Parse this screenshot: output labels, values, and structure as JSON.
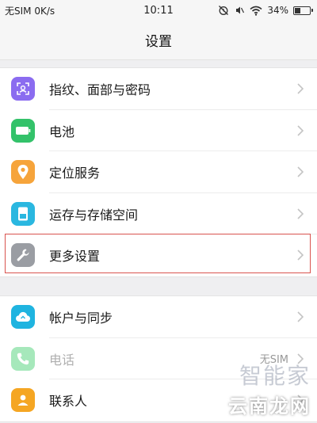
{
  "status_bar": {
    "carrier": "无SIM 0K/s",
    "time": "10:11",
    "battery": "34%",
    "battery_level": 0.34
  },
  "header": {
    "title": "设置"
  },
  "group1": [
    {
      "label": "指纹、面部与密码",
      "icon": "fingerprint-face-icon",
      "color": "#8b6cf0"
    },
    {
      "label": "电池",
      "icon": "battery-icon",
      "color": "#33c26a"
    },
    {
      "label": "定位服务",
      "icon": "location-pin-icon",
      "color": "#f6a43b"
    },
    {
      "label": "运存与存储空间",
      "icon": "storage-icon",
      "color": "#2ab7e0"
    },
    {
      "label": "更多设置",
      "icon": "wrench-icon",
      "color": "#9a9da3"
    }
  ],
  "group2": [
    {
      "label": "帐户与同步",
      "icon": "cloud-sync-icon",
      "color": "#1fb4e0"
    },
    {
      "label": "电话",
      "icon": "phone-icon",
      "color": "#3ccd6b",
      "value": "无SIM",
      "disabled": true
    },
    {
      "label": "联系人",
      "icon": "contacts-icon",
      "color": "#f5a623"
    }
  ],
  "watermark": {
    "top": "智能家",
    "bottom": "云南龙网"
  }
}
